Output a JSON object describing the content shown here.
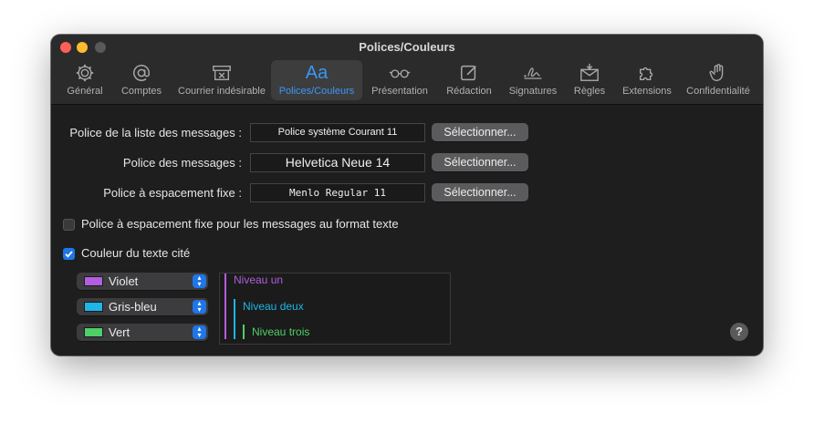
{
  "window": {
    "title": "Polices/Couleurs"
  },
  "toolbar": {
    "items": [
      {
        "label": "Général",
        "icon": "gear-icon"
      },
      {
        "label": "Comptes",
        "icon": "at-icon"
      },
      {
        "label": "Courrier indésirable",
        "icon": "junk-icon"
      },
      {
        "label": "Polices/Couleurs",
        "icon": "fonts-icon",
        "glyph": "Aa"
      },
      {
        "label": "Présentation",
        "icon": "glasses-icon"
      },
      {
        "label": "Rédaction",
        "icon": "compose-icon"
      },
      {
        "label": "Signatures",
        "icon": "signature-icon"
      },
      {
        "label": "Règles",
        "icon": "rules-icon"
      },
      {
        "label": "Extensions",
        "icon": "puzzle-icon"
      },
      {
        "label": "Confidentialité",
        "icon": "hand-icon"
      }
    ],
    "active_index": 3
  },
  "fonts": {
    "message_list": {
      "label": "Police de la liste des messages :",
      "value": "Police système Courant 11",
      "button": "Sélectionner..."
    },
    "messages": {
      "label": "Police des messages :",
      "value": "Helvetica Neue 14",
      "button": "Sélectionner..."
    },
    "fixed": {
      "label": "Police à espacement fixe :",
      "value": "Menlo Regular 11",
      "button": "Sélectionner..."
    }
  },
  "options": {
    "fixed_width_plain": {
      "label": "Police à espacement fixe pour les messages au format texte",
      "checked": false
    },
    "quoted_color": {
      "label": "Couleur du texte cité",
      "checked": true
    }
  },
  "quote_levels": [
    {
      "color_name": "Violet",
      "color": "#b35ddf",
      "preview": "Niveau un"
    },
    {
      "color_name": "Gris-bleu",
      "color": "#1eb5e8",
      "preview": "Niveau deux"
    },
    {
      "color_name": "Vert",
      "color": "#4fcf68",
      "preview": "Niveau trois"
    }
  ],
  "help": {
    "glyph": "?"
  },
  "colors": {
    "accent": "#1f76e8",
    "active_label": "#3b97f7"
  }
}
